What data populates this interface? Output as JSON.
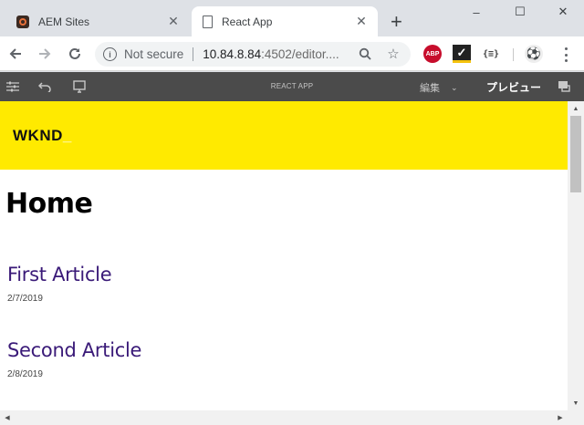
{
  "browser": {
    "tabs": [
      {
        "title": "AEM Sites",
        "icon": "aem-icon",
        "active": false
      },
      {
        "title": "React App",
        "icon": "page-icon",
        "active": true
      }
    ],
    "new_tab_glyph": "+",
    "window_controls": {
      "minimize": "–",
      "maximize": "☐",
      "close": "✕"
    },
    "address": {
      "security_label": "Not secure",
      "host": "10.84.8.84",
      "rest": ":4502/editor...."
    }
  },
  "aem_bar": {
    "title": "REACT APP",
    "mode_label": "編集",
    "preview_label": "プレビュー"
  },
  "page": {
    "logo_text": "WKND",
    "logo_suffix": "_",
    "title": "Home",
    "articles": [
      {
        "title": "First Article",
        "date": "2/7/2019"
      },
      {
        "title": "Second Article",
        "date": "2/8/2019"
      }
    ]
  },
  "colors": {
    "brand_yellow": "#ffea00",
    "article_link": "#3a1a78",
    "aem_bar": "#4b4b4b",
    "tabstrip": "#dee1e6"
  }
}
